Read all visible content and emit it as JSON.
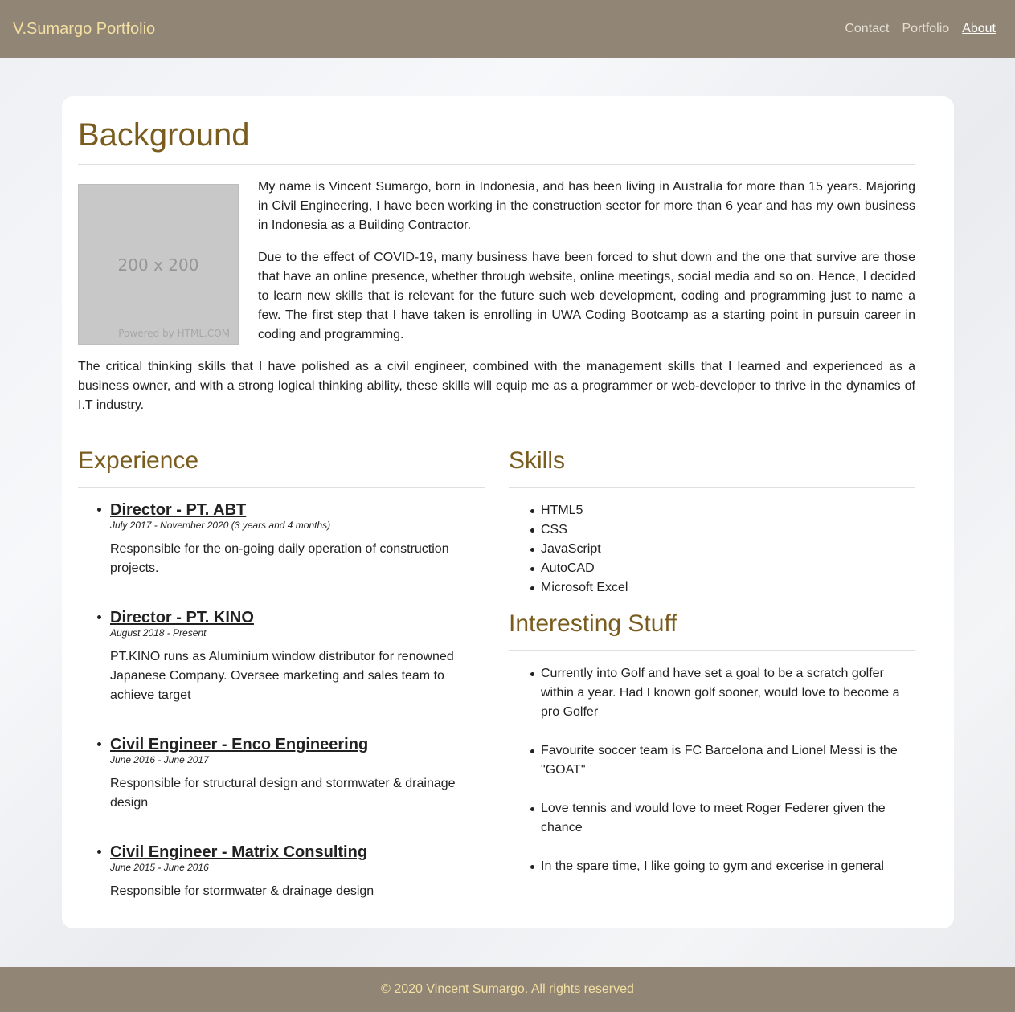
{
  "navbar": {
    "brand": "V.Sumargo Portfolio",
    "links": [
      {
        "label": "Contact"
      },
      {
        "label": "Portfolio"
      },
      {
        "label": "About"
      }
    ]
  },
  "background": {
    "heading": "Background",
    "photo_placeholder": "200 x 200",
    "photo_credit": "Powered by HTML.COM",
    "paragraphs": [
      "My name is Vincent Sumargo, born in Indonesia, and has been living in Australia for more than 15 years. Majoring in Civil Engineering, I have been working in the construction sector for more than 6 year and has my own business in Indonesia as a Building Contractor.",
      "Due to the effect of COVID-19, many business have been forced to shut down and the one that survive are those that have an online presence, whether through website, online meetings, social media and so on. Hence, I decided to learn new skills that is relevant for the future such web development, coding and programming just to name a few. The first step that I have taken is enrolling in UWA Coding Bootcamp as a starting point in pursuin career in coding and programming.",
      "The critical thinking skills that I have polished as a civil engineer, combined with the management skills that I learned and experienced as a business owner, and with a strong logical thinking ability, these skills will equip me as a programmer or web-developer to thrive in the dynamics of I.T industry."
    ]
  },
  "experience": {
    "heading": "Experience",
    "jobs": [
      {
        "title": "Director - PT. ABT",
        "dates": "July 2017 - November 2020 (3 years and 4 months)",
        "desc": "Responsible for the on-going daily operation of construction projects."
      },
      {
        "title": "Director - PT. KINO",
        "dates": "August 2018 - Present",
        "desc": "PT.KINO runs as Aluminium window distributor for renowned Japanese Company. Oversee marketing and sales team to achieve target"
      },
      {
        "title": "Civil Engineer - Enco Engineering",
        "dates": "June 2016 - June 2017",
        "desc": "Responsible for structural design and stormwater & drainage design"
      },
      {
        "title": "Civil Engineer - Matrix Consulting",
        "dates": "June 2015 - June 2016",
        "desc": "Responsible for stormwater & drainage design"
      }
    ]
  },
  "skills": {
    "heading": "Skills",
    "items": [
      "HTML5",
      "CSS",
      "JavaScript",
      "AutoCAD",
      "Microsoft Excel"
    ]
  },
  "interesting": {
    "heading": "Interesting Stuff",
    "items": [
      "Currently into Golf and have set a goal to be a scratch golfer within a year. Had I known golf sooner, would love to become a pro Golfer",
      "Favourite soccer team is FC Barcelona and Lionel Messi is the \"GOAT\"",
      "Love tennis and would love to meet Roger Federer given the chance",
      "In the spare time, I like going to gym and excerise in general"
    ]
  },
  "footer": {
    "text": "© 2020 Vincent Sumargo. All rights reserved"
  }
}
